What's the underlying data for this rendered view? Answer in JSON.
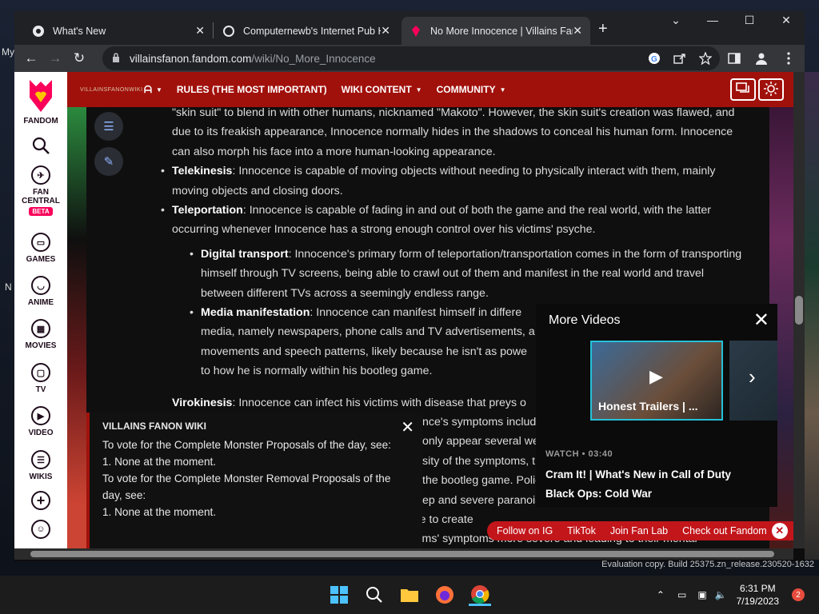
{
  "desktop": {
    "left_label_1": "My",
    "left_label_2": "N",
    "eval_text": "Evaluation copy. Build 25375.zn_release.230520-1632"
  },
  "browser": {
    "tabs": [
      {
        "title": "What's New",
        "icon": "chrome-icon",
        "close": "✕"
      },
      {
        "title": "Computernewb's Internet Pub H",
        "icon": "pub-icon",
        "close": "✕"
      },
      {
        "title": "No More Innocence | Villains Fan",
        "icon": "fandom-icon",
        "close": "✕"
      }
    ],
    "new_tab": "+",
    "window_controls": {
      "dropdown": "⌄",
      "minimize": "—",
      "maximize": "☐",
      "close": "✕"
    },
    "nav": {
      "back": "←",
      "forward": "→",
      "reload": "↻"
    },
    "url_host": "villainsfanon.fandom.com",
    "url_path": "/wiki/No_More_Innocence"
  },
  "rail": {
    "items": [
      {
        "label": "FANDOM",
        "icon": "fandom-logo-icon"
      },
      {
        "label": "",
        "icon": "search-icon"
      },
      {
        "label": "FAN CENTRAL",
        "icon": "rocket-icon",
        "badge": "BETA"
      },
      {
        "label": "GAMES",
        "icon": "gamepad-icon"
      },
      {
        "label": "ANIME",
        "icon": "anime-icon"
      },
      {
        "label": "MOVIES",
        "icon": "movie-icon"
      },
      {
        "label": "TV",
        "icon": "tv-icon"
      },
      {
        "label": "VIDEO",
        "icon": "video-icon"
      },
      {
        "label": "WIKIS",
        "icon": "book-icon"
      }
    ]
  },
  "wiki_header": {
    "logo_text": "VILLAINSFANONWIKI",
    "nav": [
      "RULES (THE MOST IMPORTANT)",
      "WIKI CONTENT",
      "COMMUNITY"
    ]
  },
  "article": {
    "intro": "\"skin suit\" to blend in with other humans, nicknamed \"Makoto\". However, the skin suit's creation was flawed, and due to its freakish appearance, Innocence normally hides in the shadows to conceal his human form. Innocence can also morph his face into a more human-looking appearance.",
    "items": [
      {
        "term": "Telekinesis",
        "text": ": Innocence is capable of moving objects without needing to physically interact with them, mainly moving objects and closing doors."
      },
      {
        "term": "Teleportation",
        "text": ": Innocence is capable of fading in and out of both the game and the real world, with the latter occurring whenever Innocence has a strong enough control over his victims' psyche."
      }
    ],
    "subitems": [
      {
        "term": "Digital transport",
        "text": ": Innocence's primary form of teleportation/transportation comes in the form of transporting himself through TV screens, being able to crawl out of them and manifest in the real world and travel between different TVs across a seemingly endless range."
      },
      {
        "term": "Media manifestation",
        "text": ": Innocence can manifest himself in differe media, namely newspapers, phone calls and TV advertisements, a movements and speech patterns, likely because he isn't as powe to how he is normally within his bootleg game."
      }
    ],
    "virokinesis_term": "Virokinesis",
    "virokinesis_text": ": Innocence can infect his victims with disease that preys o",
    "partial_lines": [
      "nce's symptoms include",
      "only appear several wee",
      "sity of the symptoms, th",
      "the bootleg game. Polic",
      "ep and severe paranoia"
    ],
    "disease_line": "Disease augmentation: As well as being able to create",
    "bottom_line": "enhance their effectiveness, making his victims' symptoms more severe and leading to their mental"
  },
  "notice": {
    "title": "VILLAINS FANON WIKI",
    "lines": [
      "To vote for the Complete Monster Proposals of the day, see:",
      "1. None at the moment.",
      "To vote for the Complete Monster Removal Proposals of the day, see:",
      "1. None at the moment."
    ]
  },
  "video": {
    "header": "More Videos",
    "thumb_caption": "Honest Trailers | ...",
    "watch_label": "WATCH • 03:40",
    "title": "Cram It! | What's New in Call of Duty Black Ops: Cold War"
  },
  "followbar": {
    "items": [
      "Follow on IG",
      "TikTok",
      "Join Fan Lab",
      "Check out Fandom"
    ]
  },
  "taskbar": {
    "time": "6:31 PM",
    "date": "7/19/2023",
    "notifications": "2",
    "apps": [
      "windows-start-icon",
      "search-icon",
      "file-explorer-icon",
      "firefox-icon",
      "chrome-icon"
    ]
  }
}
